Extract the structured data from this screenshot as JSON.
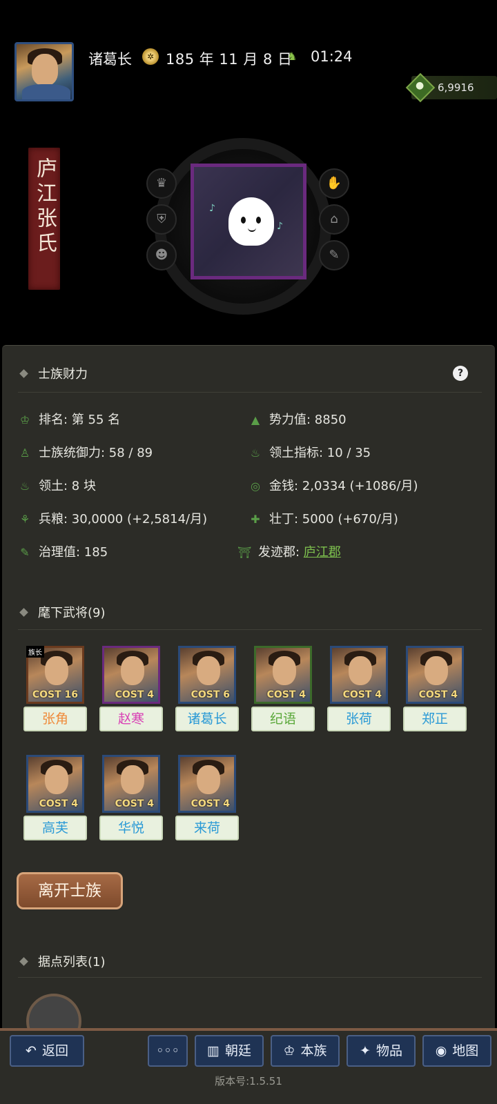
{
  "header": {
    "player_name": "诸葛长",
    "date": "185 年 11 月 8 日",
    "time": "01:24",
    "currency_amount": "6,9916"
  },
  "clan": {
    "banner_text": "庐江张氏"
  },
  "wealth_section": {
    "title": "士族财力",
    "help": "?",
    "stats": {
      "rank": "排名: 第 55 名",
      "power": "势力值: 8850",
      "control": "士族统御力: 58 / 89",
      "territory_index": "领土指标: 10 / 35",
      "territory": "领土: 8 块",
      "money": "金钱: 2,0334 (+1086/月)",
      "food": "兵粮: 30,0000 (+2,5814/月)",
      "manpower": "壮丁: 5000 (+670/月)",
      "governance": "治理值: 185",
      "origin_label": "发迹郡: ",
      "origin_link": "庐江郡"
    }
  },
  "generals_section": {
    "title": "麾下武将(9)",
    "leader_badge": "族长",
    "cost_label": "COST",
    "generals": [
      {
        "name": "张角",
        "cost": "16",
        "name_color": "#ef8a3a",
        "frame_color": "#6a3a1e"
      },
      {
        "name": "赵寒",
        "cost": "4",
        "name_color": "#d93fb5",
        "frame_color": "#6a2a7e"
      },
      {
        "name": "诸葛长",
        "cost": "6",
        "name_color": "#2b9ad6",
        "frame_color": "#2b4a78"
      },
      {
        "name": "纪语",
        "cost": "4",
        "name_color": "#5aa83a",
        "frame_color": "#3c6a2a"
      },
      {
        "name": "张荷",
        "cost": "4",
        "name_color": "#2b9ad6",
        "frame_color": "#2b4a78"
      },
      {
        "name": "郑正",
        "cost": "4",
        "name_color": "#2b9ad6",
        "frame_color": "#2b4a78"
      },
      {
        "name": "高芙",
        "cost": "4",
        "name_color": "#2b9ad6",
        "frame_color": "#2b4a78"
      },
      {
        "name": "华悦",
        "cost": "4",
        "name_color": "#2b9ad6",
        "frame_color": "#2b4a78"
      },
      {
        "name": "来荷",
        "cost": "4",
        "name_color": "#2b9ad6",
        "frame_color": "#2b4a78"
      }
    ]
  },
  "leave_button": "离开士族",
  "strongholds_section": {
    "title": "据点列表(1)"
  },
  "bottom_nav": {
    "back": "返回",
    "more": "◦◦◦",
    "court": "朝廷",
    "clan": "本族",
    "items": "物品",
    "map": "地图"
  },
  "version": "版本号:1.5.51"
}
